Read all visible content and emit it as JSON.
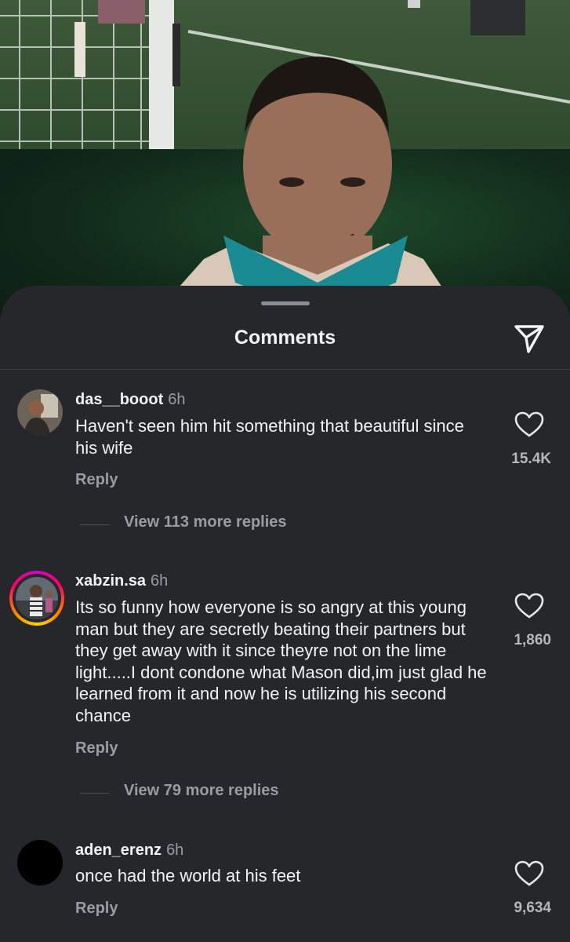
{
  "sheet": {
    "title": "Comments",
    "share_icon": "paper-plane-icon"
  },
  "comments": [
    {
      "username": "das__booot",
      "time": "6h",
      "text": "Haven't seen him hit something that beautiful since his wife",
      "likes": "15.4K",
      "reply_label": "Reply",
      "more_replies": "View 113 more replies",
      "has_story_ring": false
    },
    {
      "username": "xabzin.sa",
      "time": "6h",
      "text": "Its so funny how everyone is so angry at this young man but they are secretly beating their partners but they get away with it since theyre not on the lime light.....I dont condone what Mason did,im just glad he learned from it and now he is utilizing his second chance",
      "likes": "1,860",
      "reply_label": "Reply",
      "more_replies": "View 79 more replies",
      "has_story_ring": true
    },
    {
      "username": "aden_erenz",
      "time": "6h",
      "text": "once had the world at his feet",
      "likes": "9,634",
      "reply_label": "Reply",
      "has_story_ring": false
    }
  ],
  "colors": {
    "sheet_bg": "#25272b",
    "text_primary": "#f2f3f5",
    "text_secondary": "#9a9ca1"
  },
  "icons": {
    "like": "heart-outline-icon",
    "share": "paper-plane-icon"
  }
}
